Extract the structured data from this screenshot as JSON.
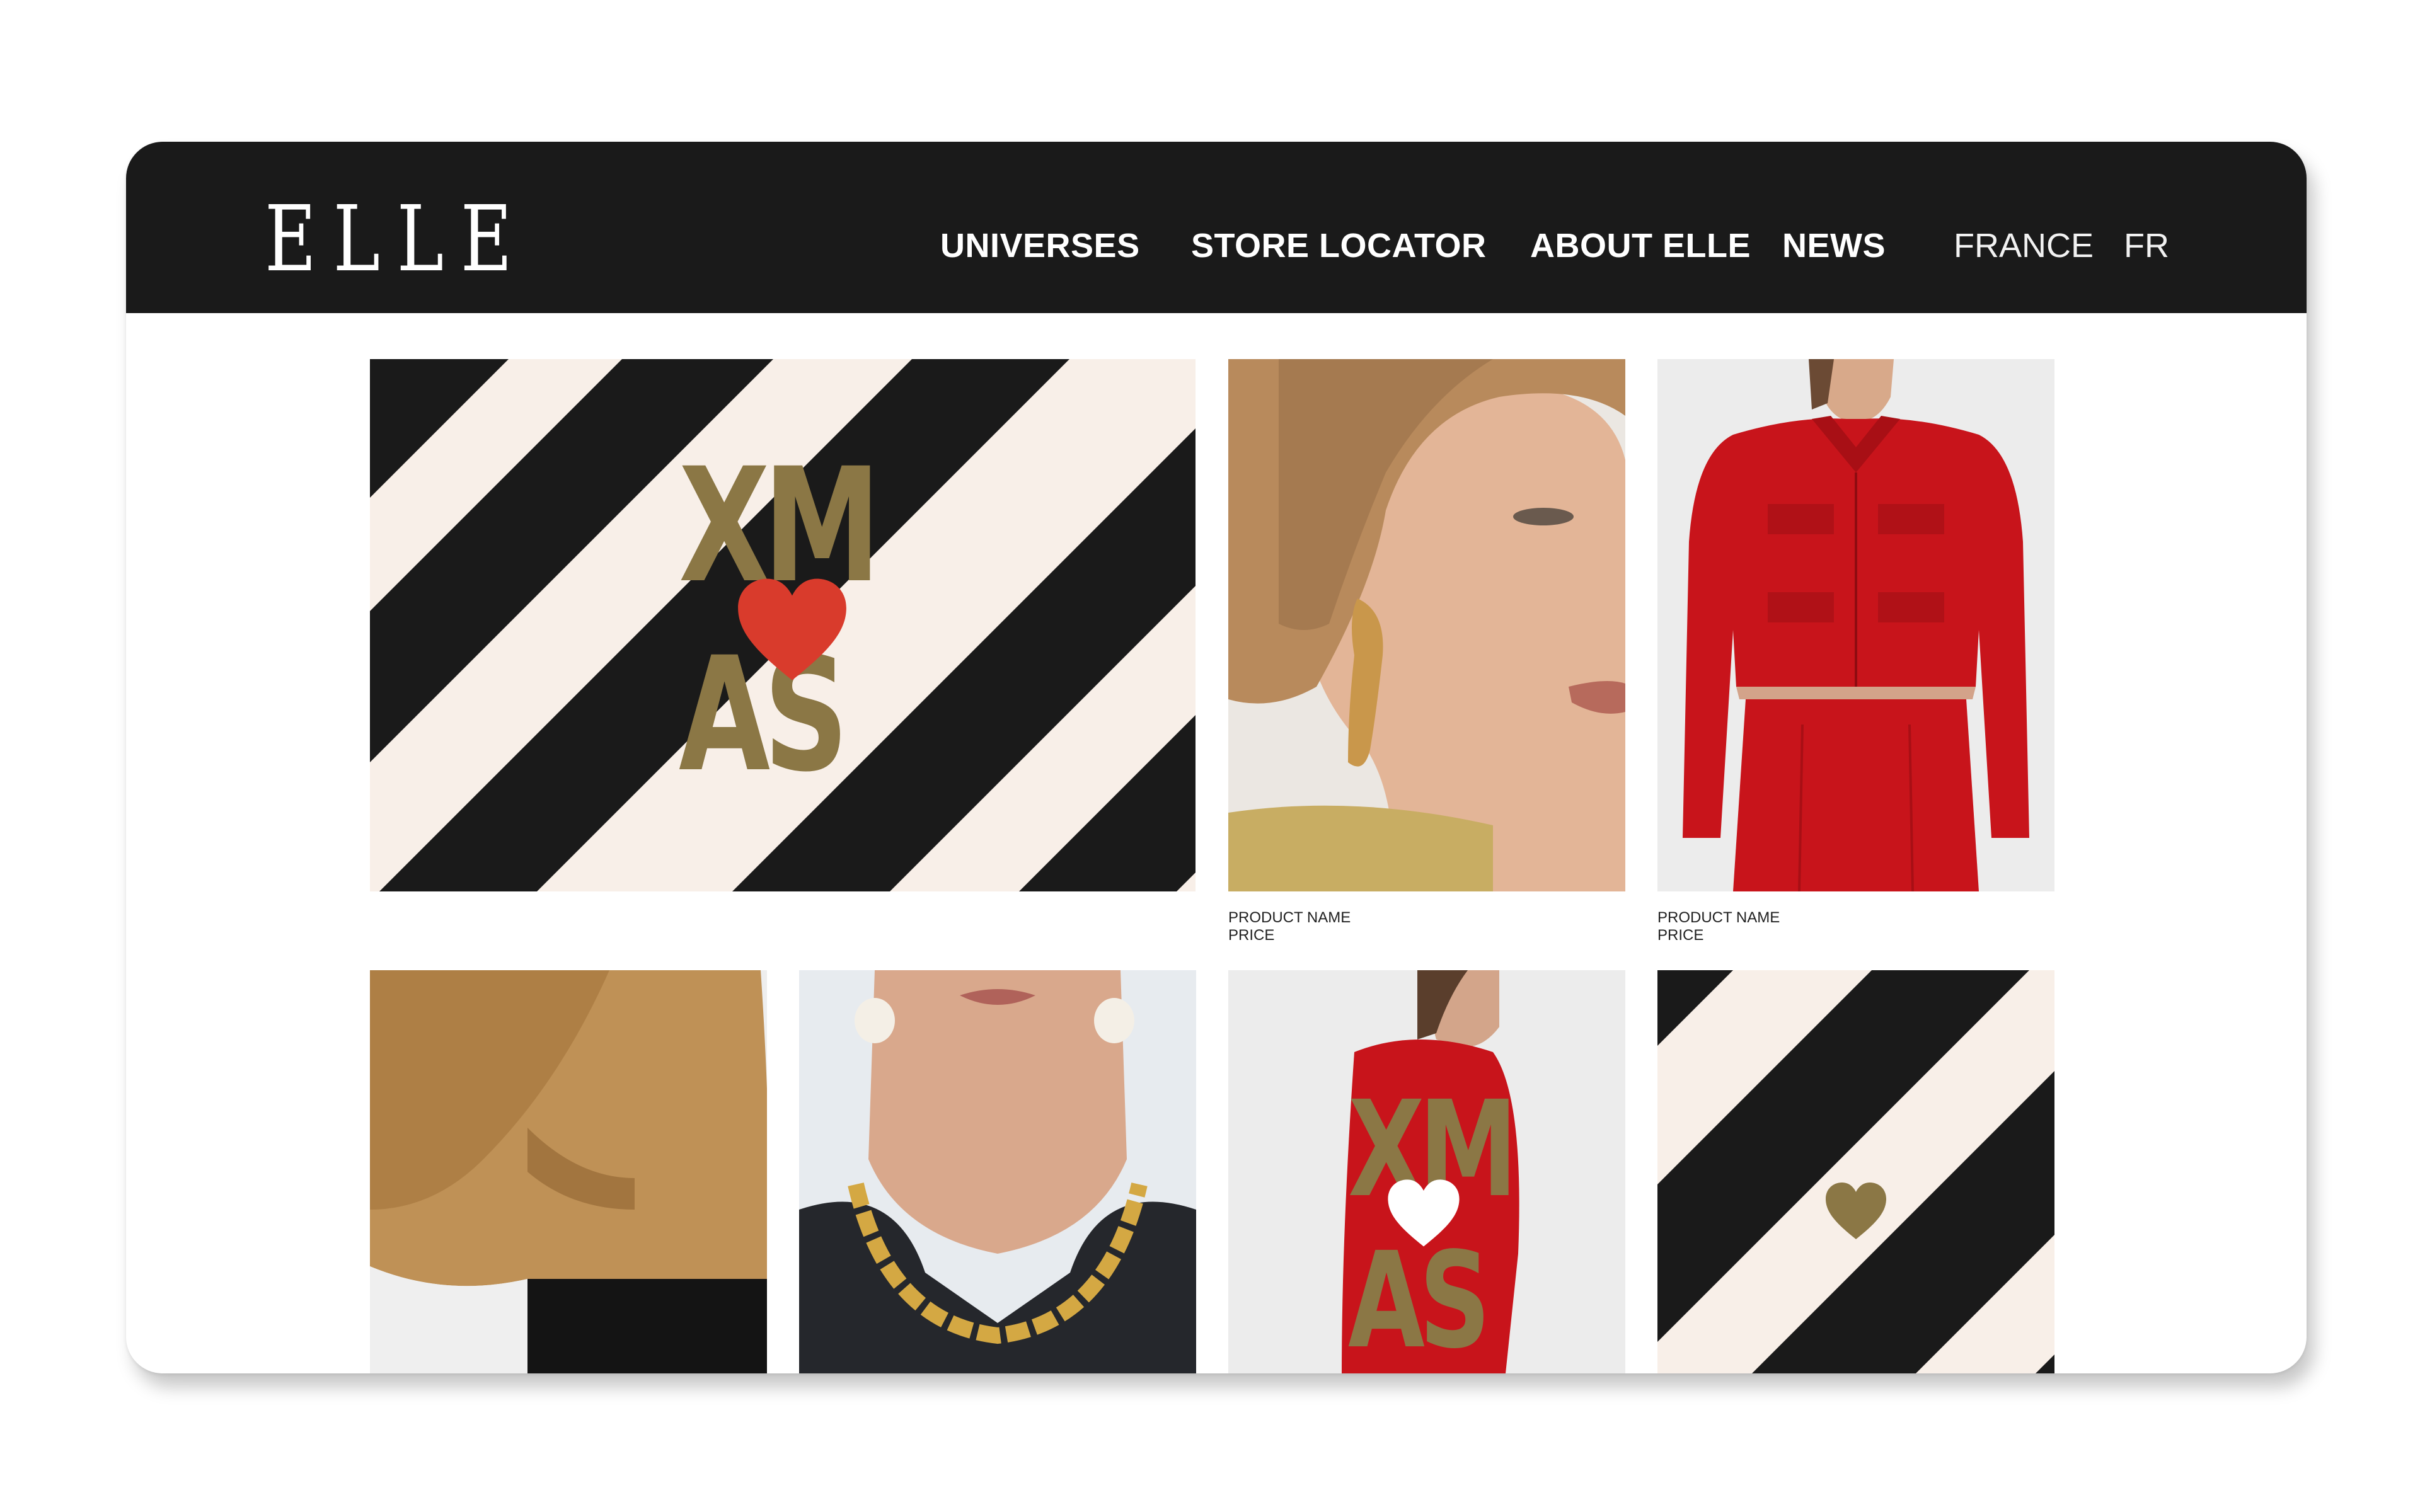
{
  "header": {
    "logo": "ELLE",
    "nav": {
      "universes": "UNIVERSES",
      "store_locator": "STORE LOCATOR",
      "about": "ABOUT ELLE",
      "news": "NEWS",
      "country": "FRANCE",
      "language": "FR"
    }
  },
  "colors": {
    "bar": "#1a1a1a",
    "stripe_dark": "#1a1a1a",
    "stripe_light": "#f8efe8",
    "gold": "#8b7745",
    "red_heart": "#d93b2c",
    "red_garment": "#c8141b"
  },
  "grid": {
    "hero_banner": {
      "line1": "XM",
      "line2": "AS",
      "icon": "heart-icon"
    },
    "product_1": {
      "name": "PRODUCT NAME",
      "price": "PRICE"
    },
    "product_2": {
      "name": "PRODUCT NAME",
      "price": "PRICE"
    },
    "promo_tile": {
      "line1": "XM",
      "line2": "AS",
      "icon": "heart-icon"
    },
    "pattern_tile": {
      "icon": "heart-icon"
    }
  }
}
